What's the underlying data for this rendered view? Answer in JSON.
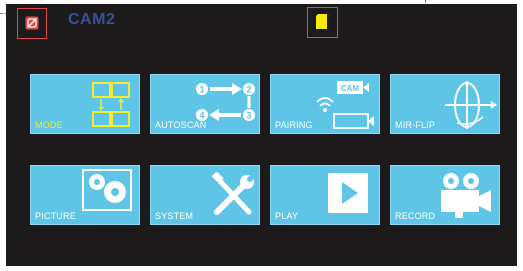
{
  "header": {
    "title": "CAM2",
    "camera_status_icon": "camera-off-icon",
    "sd_card_icon": "sd-card-icon"
  },
  "tiles": [
    {
      "label": "MODE",
      "icon": "quad-split-icon",
      "highlight": true
    },
    {
      "label": "AUTOSCAN",
      "icon": "autoscan-cycle-icon",
      "highlight": false
    },
    {
      "label": "PAIRING",
      "icon": "pairing-wireless-icon",
      "highlight": false,
      "icon_text": "CAM"
    },
    {
      "label": "MIR-FLIP",
      "icon": "mirror-flip-icon",
      "highlight": false
    },
    {
      "label": "PICTURE",
      "icon": "picture-settings-icon",
      "highlight": false
    },
    {
      "label": "SYSTEM",
      "icon": "tools-icon",
      "highlight": false
    },
    {
      "label": "PLAY",
      "icon": "play-icon",
      "highlight": false
    },
    {
      "label": "RECORD",
      "icon": "video-camera-icon",
      "highlight": false
    }
  ],
  "autoscan_numbers": [
    "1",
    "2",
    "3",
    "4"
  ],
  "colors": {
    "screen_bg": "#1c1a1a",
    "tile_bg": "#5ec5e6",
    "highlight": "#f2ec2e",
    "title": "#3d4f9a",
    "callout": "#e04848"
  }
}
